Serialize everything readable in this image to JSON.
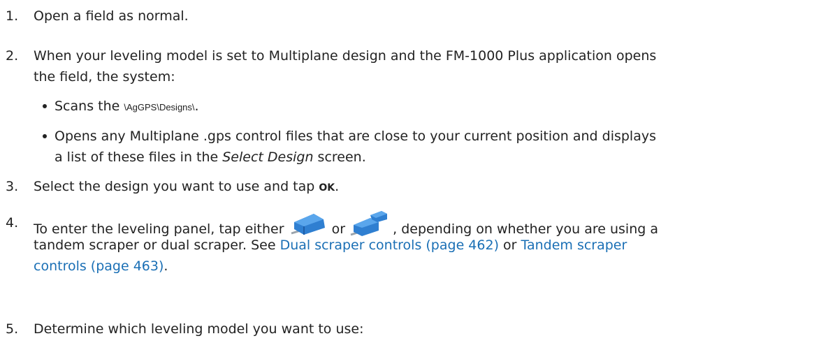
{
  "steps": [
    {
      "num": "1.",
      "text": "Open a field as normal."
    },
    {
      "num": "2.",
      "line1": "When your leveling model is set to Multiplane design and the FM-1000 Plus application opens",
      "line2": "the field, the system:"
    },
    {
      "num": "3.",
      "text_before": "Select the design you want to use and tap ",
      "ok": "OK",
      "text_after": "."
    },
    {
      "num": "4.",
      "lead": "To enter the leveling panel, tap either ",
      "or": " or ",
      "tail": ", depending on whether you are using a",
      "line2_before": "tandem scraper or dual scraper. See ",
      "link1": "Dual scraper controls (page 462)",
      "mid": " or ",
      "link2_part1": "Tandem scraper",
      "link2_part2": "controls (page 463)",
      "end": "."
    },
    {
      "num": "5.",
      "text": "Determine which leveling model you want to use:"
    }
  ],
  "bullets": [
    {
      "before": "Scans the ",
      "path": "\\AgGPS\\Designs\\",
      "after": "."
    },
    {
      "line1": "Opens any Multiplane .gps control files that are close to your current position and displays",
      "line2_before": "a list of these files in the ",
      "italic": "Select Design",
      "line2_after": " screen."
    }
  ],
  "icons": [
    "dual-scraper-icon",
    "tandem-scraper-icon"
  ],
  "colors": {
    "text": "#222222",
    "link": "#1a6fb5",
    "icon_blue": "#2f7fd1"
  }
}
